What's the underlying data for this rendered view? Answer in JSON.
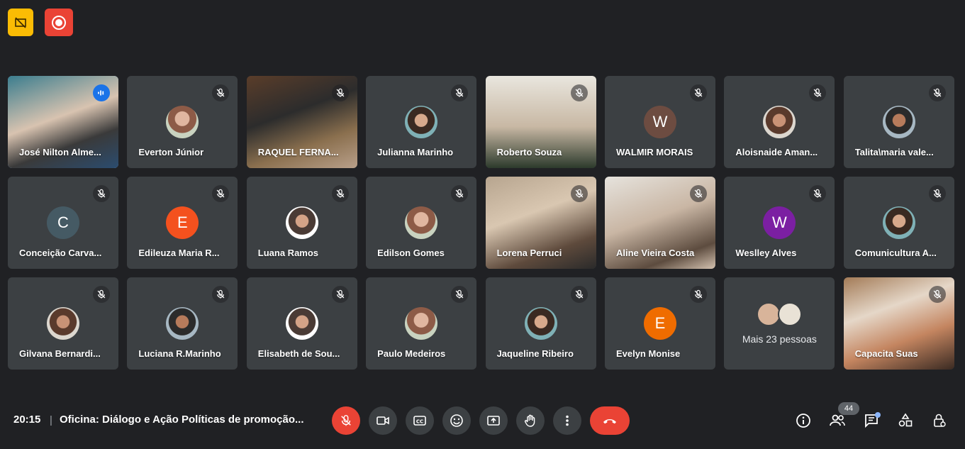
{
  "participants": [
    {
      "name": "José Nilton Alme...",
      "type": "video",
      "speaking": true
    },
    {
      "name": "Everton Júnior",
      "type": "photo"
    },
    {
      "name": "RAQUEL FERNA...",
      "type": "video"
    },
    {
      "name": "Julianna Marinho",
      "type": "photo"
    },
    {
      "name": "Roberto Souza",
      "type": "video"
    },
    {
      "name": "WALMIR MORAIS",
      "type": "initial",
      "initial": "W",
      "color": "#6d4c41"
    },
    {
      "name": "Aloisnaide Aman...",
      "type": "photo"
    },
    {
      "name": "Talita\\maria vale...",
      "type": "photo"
    },
    {
      "name": "Conceição Carva...",
      "type": "initial",
      "initial": "C",
      "color": "#455a64"
    },
    {
      "name": "Edileuza Maria R...",
      "type": "initial",
      "initial": "E",
      "color": "#f4511e"
    },
    {
      "name": "Luana Ramos",
      "type": "photo"
    },
    {
      "name": "Edilson Gomes",
      "type": "photo"
    },
    {
      "name": "Lorena Perruci",
      "type": "video"
    },
    {
      "name": "Aline Vieira Costa",
      "type": "video"
    },
    {
      "name": "Weslley Alves",
      "type": "initial",
      "initial": "W",
      "color": "#7b1fa2"
    },
    {
      "name": "Comunicultura A...",
      "type": "photo"
    },
    {
      "name": "Gilvana Bernardi...",
      "type": "photo"
    },
    {
      "name": "Luciana R.Marinho",
      "type": "photo"
    },
    {
      "name": "Elisabeth de Sou...",
      "type": "photo"
    },
    {
      "name": "Paulo Medeiros",
      "type": "photo"
    },
    {
      "name": "Jaqueline Ribeiro",
      "type": "photo"
    },
    {
      "name": "Evelyn Monise",
      "type": "initial",
      "initial": "E",
      "color": "#ef6c00"
    },
    {
      "name": "",
      "type": "more"
    },
    {
      "name": "Capacita Suas",
      "type": "video"
    }
  ],
  "more_label": "Mais 23 pessoas",
  "bottom_bar": {
    "time": "20:15",
    "separator": "|",
    "meeting_title": "Oficina: Diálogo e Ação Políticas de promoção...",
    "people_count": "44"
  },
  "colors": {
    "accent": "#8ab4f8",
    "danger": "#ea4335",
    "tile": "#3c4043",
    "background": "#202124"
  },
  "icons": [
    "no-presenting-icon",
    "record-icon",
    "mic-off-icon",
    "mic-active-icon",
    "camera-icon",
    "captions-icon",
    "emoji-icon",
    "present-icon",
    "raise-hand-icon",
    "more-options-icon",
    "end-call-icon",
    "info-icon",
    "people-icon",
    "chat-icon",
    "activities-icon",
    "host-controls-icon"
  ]
}
